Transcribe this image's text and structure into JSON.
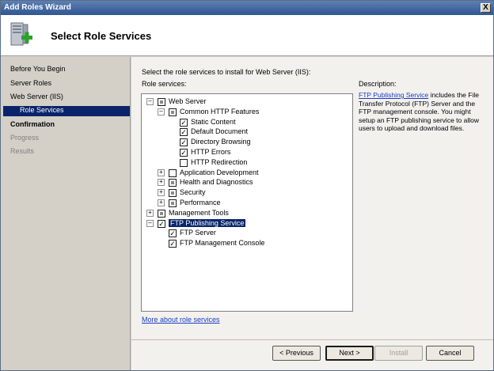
{
  "window": {
    "title": "Add Roles Wizard",
    "close_label": "X"
  },
  "header": {
    "page_title": "Select Role Services"
  },
  "nav": {
    "items": [
      {
        "label": "Before You Begin",
        "state": "normal"
      },
      {
        "label": "Server Roles",
        "state": "normal"
      },
      {
        "label": "Web Server (IIS)",
        "state": "normal"
      },
      {
        "label": "Role Services",
        "state": "selected"
      },
      {
        "label": "Confirmation",
        "state": "bold"
      },
      {
        "label": "Progress",
        "state": "disabled"
      },
      {
        "label": "Results",
        "state": "disabled"
      }
    ]
  },
  "content": {
    "instruction": "Select the role services to install for Web Server (IIS):",
    "role_services_label": "Role services:",
    "description_label": "Description:",
    "description_link": "FTP Publishing Service",
    "description_text": " includes the File Transfer Protocol (FTP) Server and the FTP management console. You might setup an FTP publishing service to allow users to upload and download files.",
    "more_link": "More about role services"
  },
  "tree": [
    {
      "label": "Web Server",
      "expander": "−",
      "checkbox": "partial"
    },
    {
      "label": "Common HTTP Features",
      "expander": "−",
      "checkbox": "partial"
    },
    {
      "label": "Static Content",
      "expander": "",
      "checkbox": "checked"
    },
    {
      "label": "Default Document",
      "expander": "",
      "checkbox": "checked"
    },
    {
      "label": "Directory Browsing",
      "expander": "",
      "checkbox": "checked"
    },
    {
      "label": "HTTP Errors",
      "expander": "",
      "checkbox": "checked"
    },
    {
      "label": "HTTP Redirection",
      "expander": "",
      "checkbox": "unchecked"
    },
    {
      "label": "Application Development",
      "expander": "+",
      "checkbox": "unchecked"
    },
    {
      "label": "Health and Diagnostics",
      "expander": "+",
      "checkbox": "partial"
    },
    {
      "label": "Security",
      "expander": "+",
      "checkbox": "partial"
    },
    {
      "label": "Performance",
      "expander": "+",
      "checkbox": "partial"
    },
    {
      "label": "Management Tools",
      "expander": "+",
      "checkbox": "partial"
    },
    {
      "label": "FTP Publishing Service",
      "expander": "−",
      "checkbox": "checked",
      "highlighted": true
    },
    {
      "label": "FTP Server",
      "expander": "",
      "checkbox": "checked"
    },
    {
      "label": "FTP Management Console",
      "expander": "",
      "checkbox": "checked"
    }
  ],
  "buttons": {
    "previous": "< Previous",
    "next": "Next >",
    "install": "Install",
    "cancel": "Cancel"
  },
  "colors": {
    "selection": "#0a246a",
    "link": "#1c3cc4",
    "titlebar": "#2f5691"
  }
}
